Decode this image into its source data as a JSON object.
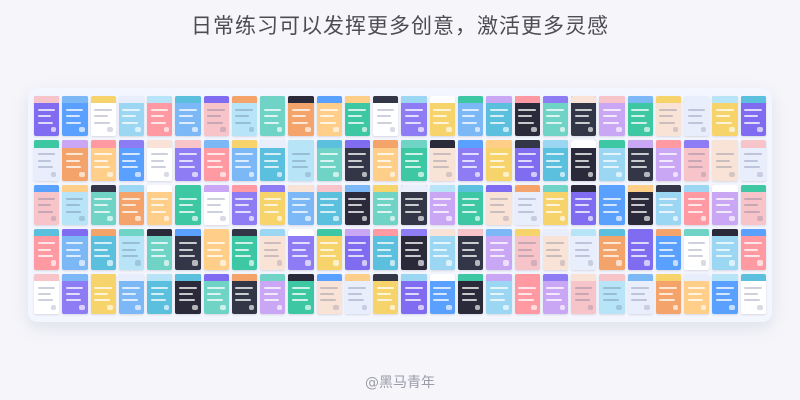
{
  "headline": "日常练习可以发挥更多创意，激活更多灵感",
  "watermark": "@黑马青年",
  "gallery": {
    "columns": 26,
    "rows": 5,
    "palette": [
      "#7f6cf0",
      "#9bd6f2",
      "#f7c5c9",
      "#f4a36a",
      "#ffffff",
      "#7db8f6",
      "#6fd3c6",
      "#3ec7a3",
      "#f6d46b",
      "#2a2a3a",
      "#c9a7f5",
      "#e9eefc",
      "#5aa0ff",
      "#ff9aa2",
      "#b7e4f7",
      "#ffcf8a",
      "#8e7cf5",
      "#5bc0de",
      "#333646",
      "#f9e3d6"
    ]
  }
}
